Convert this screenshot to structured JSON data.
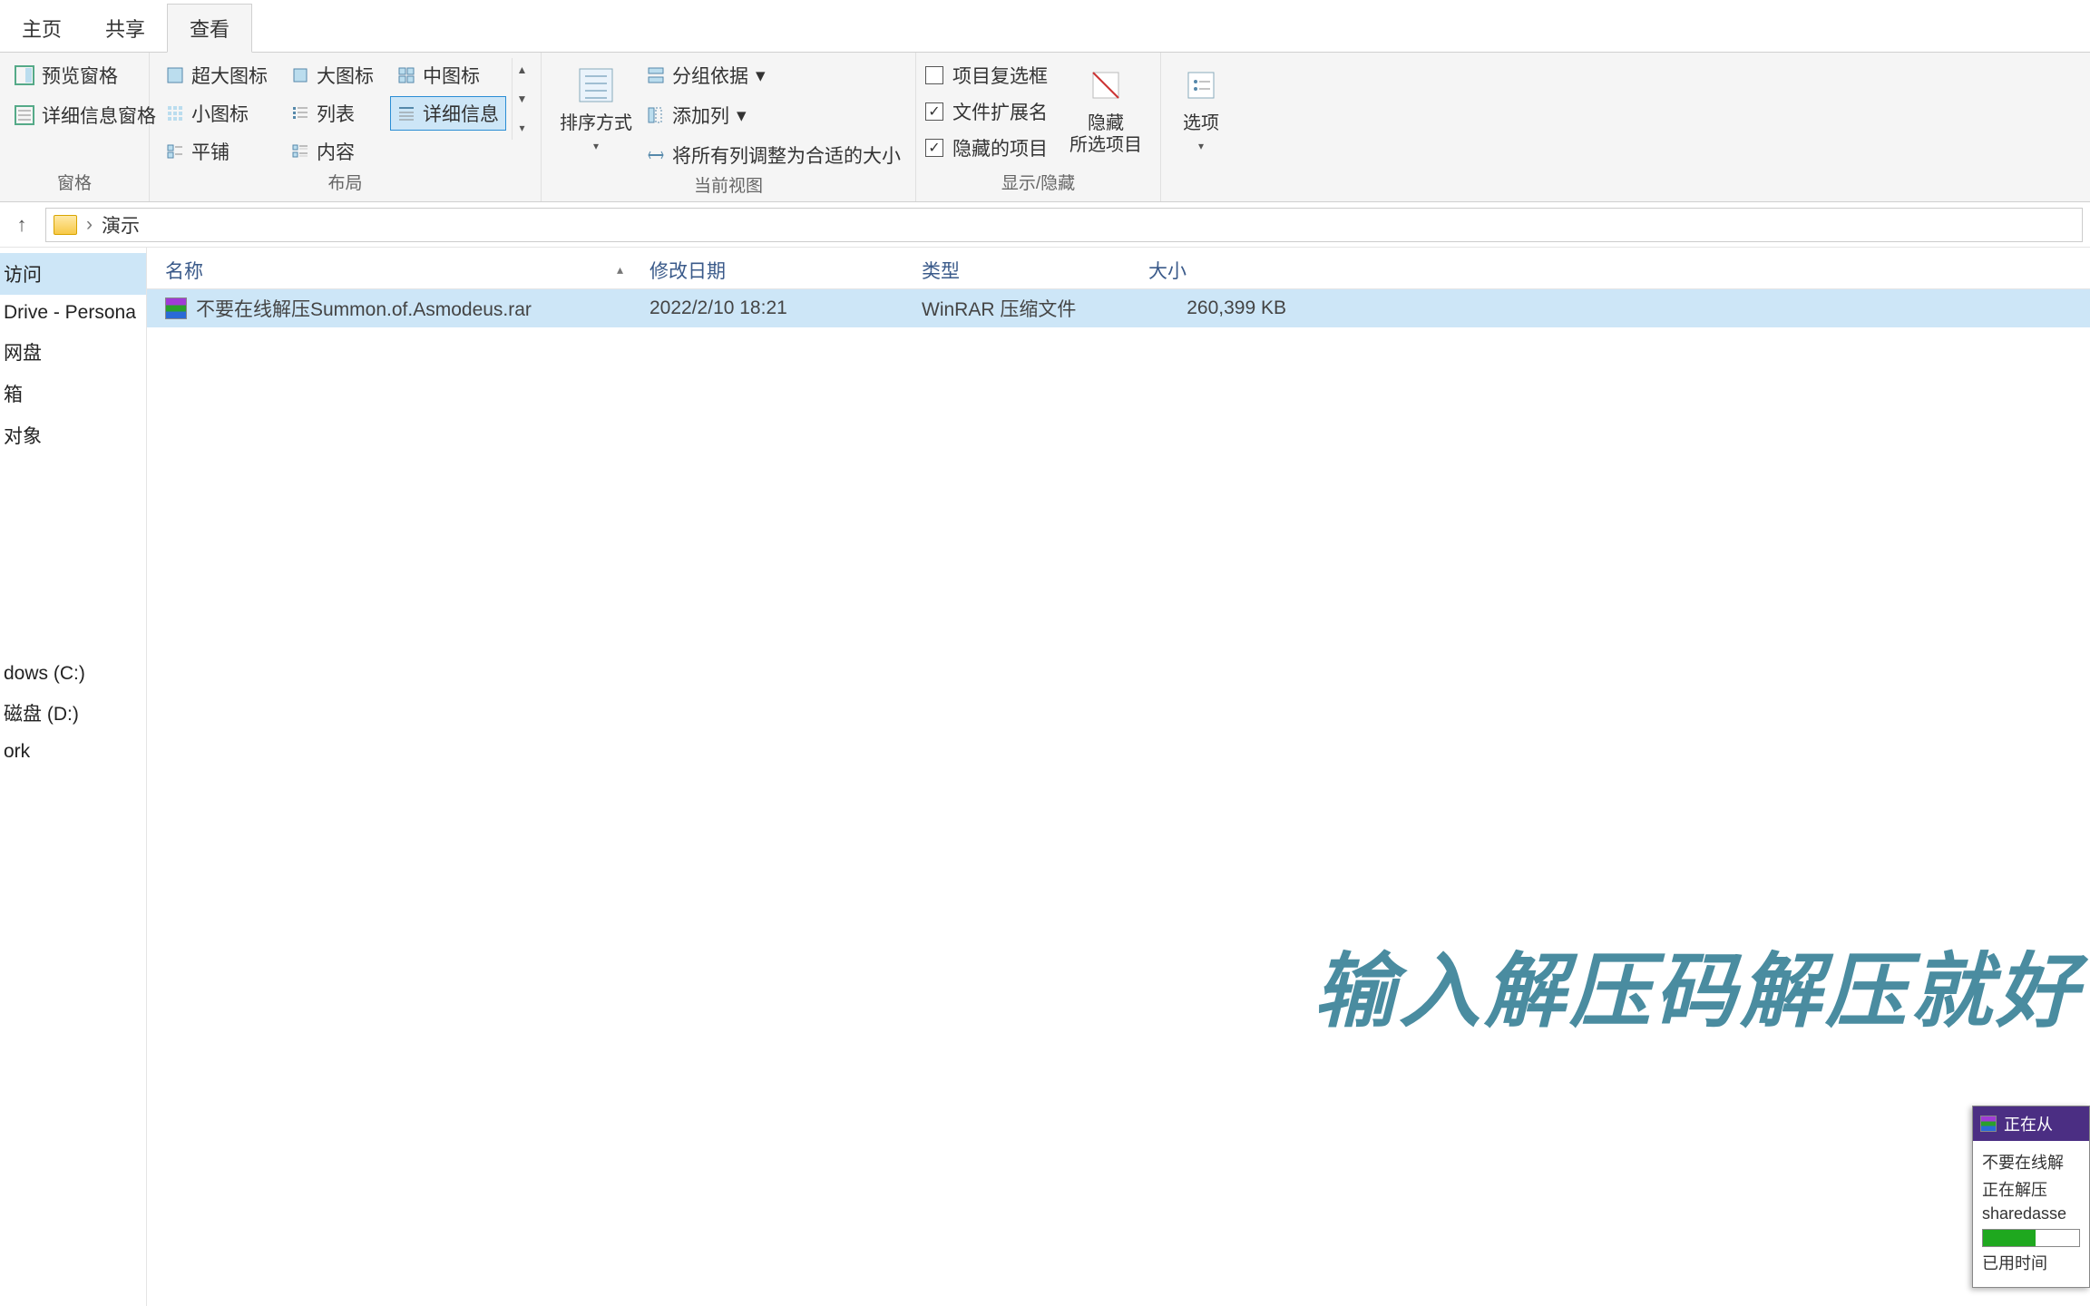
{
  "window": {
    "title": "演示"
  },
  "tabs": {
    "home": "主页",
    "share": "共享",
    "view": "查看",
    "active": "view"
  },
  "ribbon": {
    "panes": {
      "preview": "预览窗格",
      "details": "详细信息窗格",
      "group_label": "窗格"
    },
    "layout": {
      "extra_large": "超大图标",
      "large": "大图标",
      "medium": "中图标",
      "small": "小图标",
      "list": "列表",
      "details": "详细信息",
      "tiles": "平铺",
      "content": "内容",
      "group_label": "布局"
    },
    "sort": {
      "label": "排序方式"
    },
    "currentview": {
      "groupby": "分组依据",
      "addcolumn": "添加列",
      "sizeall": "将所有列调整为合适的大小",
      "group_label": "当前视图"
    },
    "showhide": {
      "itemcheck": "项目复选框",
      "fileext": "文件扩展名",
      "hiddenitems": "隐藏的项目",
      "hide_selected": "隐藏\n所选项目",
      "group_label": "显示/隐藏",
      "checked": {
        "itemcheck": false,
        "fileext": true,
        "hiddenitems": true
      }
    },
    "options": {
      "label": "选项"
    }
  },
  "address": {
    "folder": "演示",
    "sep": "›"
  },
  "sidebar": {
    "items": [
      "访问",
      "Drive - Persona",
      "网盘",
      "箱",
      "对象",
      "",
      "",
      "dows (C:)",
      "磁盘 (D:)",
      "ork"
    ],
    "selected_index": 0
  },
  "columns": {
    "name": "名称",
    "date": "修改日期",
    "type": "类型",
    "size": "大小"
  },
  "files": [
    {
      "name": "不要在线解压Summon.of.Asmodeus.rar",
      "date": "2022/2/10 18:21",
      "type": "WinRAR 压缩文件",
      "size": "260,399 KB",
      "selected": true
    }
  ],
  "overlay": {
    "text": "输入解压码解压就好"
  },
  "popup": {
    "title": "正在从",
    "line1": "不要在线解",
    "line2": "正在解压",
    "line3": "sharedasse",
    "line4": "已用时间"
  }
}
